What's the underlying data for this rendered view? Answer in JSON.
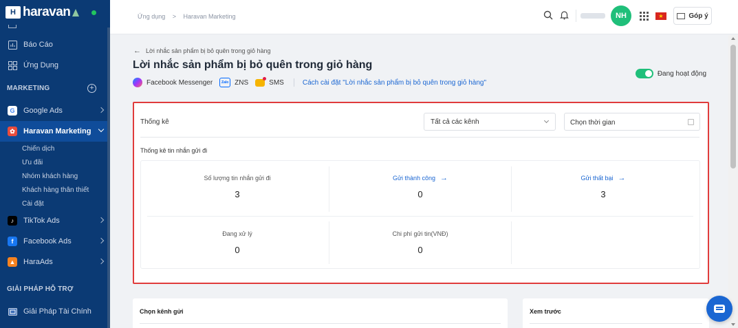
{
  "app": {
    "logo_text": "haravan",
    "logo_box": "H"
  },
  "sidebar": {
    "items_top": [
      {
        "label": "Báo Cáo",
        "icon": "chart-icon"
      },
      {
        "label": "Ứng Dụng",
        "icon": "apps-icon"
      }
    ],
    "marketing_heading": "MARKETING",
    "marketing_items": [
      {
        "label": "Google Ads",
        "icon": "google-icon",
        "color": "#ffffff"
      },
      {
        "label": "Haravan Marketing",
        "icon": "haravan-marketing-icon",
        "color": "#e84c3d"
      }
    ],
    "sub_items": [
      "Chiến dịch",
      "Ưu đãi",
      "Nhóm khách hàng",
      "Khách hàng thân thiết",
      "Cài đặt"
    ],
    "more_items": [
      {
        "label": "TikTok Ads",
        "icon": "tiktok-icon",
        "color": "#000000"
      },
      {
        "label": "Facebook Ads",
        "icon": "facebook-icon",
        "color": "#1877f2"
      },
      {
        "label": "HaraAds",
        "icon": "haraads-icon",
        "color": "#f58220"
      }
    ],
    "support_heading": "GIẢI PHÁP HỖ TRỢ",
    "support_items": [
      {
        "label": "Giải Pháp Tài Chính",
        "icon": "finance-icon"
      }
    ]
  },
  "topbar": {
    "breadcrumb": [
      "Ứng dụng",
      ">",
      "Haravan Marketing"
    ],
    "avatar_initials": "NH",
    "feedback_label": "Góp ý",
    "flag_star": "★"
  },
  "page": {
    "back_label": "Lời nhắc sản phẩm bị bỏ quên trong giỏ hàng",
    "title": "Lời nhắc sản phẩm bị bỏ quên trong giỏ hàng",
    "channels": [
      {
        "label": "Facebook Messenger",
        "icon": "messenger-icon"
      },
      {
        "label": "ZNS",
        "icon": "zalo-icon",
        "icon_text": "Zalo"
      },
      {
        "label": "SMS",
        "icon": "sms-icon"
      }
    ],
    "settings_link": "Cách cài đặt \"Lời nhắc sản phẩm bị bỏ quên trong giỏ hàng\"",
    "status_label": "Đang hoạt động"
  },
  "stats": {
    "title": "Thống kê",
    "channel_filter": "Tất cả các kênh",
    "date_placeholder": "Chọn thời gian",
    "sent_title": "Thống kê tin nhắn gửi đi",
    "cells": [
      {
        "label": "Số lượng tin nhắn gửi đi",
        "value": "3"
      },
      {
        "label": "Gửi thành công",
        "value": "0"
      },
      {
        "label": "Gửi thất bại",
        "value": "3"
      },
      {
        "label": "Đang xử lý",
        "value": "0"
      },
      {
        "label": "Chi phí gửi tin(VNĐ)",
        "value": "0"
      }
    ]
  },
  "bottom": {
    "channel_card_title": "Chọn kênh gửi",
    "preview_card_title": "Xem trước"
  },
  "colors": {
    "accent": "#1a66d2",
    "sidebar": "#0b3a74",
    "success": "#1fbf7a",
    "highlight": "#e03b3b"
  }
}
